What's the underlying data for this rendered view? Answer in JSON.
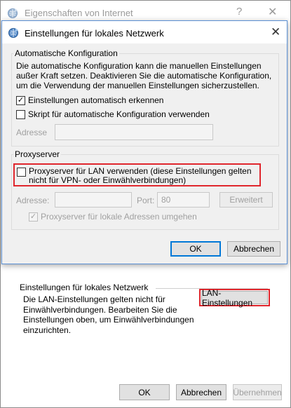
{
  "outer_window": {
    "title": "Eigenschaften von Internet",
    "help_glyph": "?",
    "close_glyph": "✕",
    "lan_group": {
      "legend": "Einstellungen für lokales Netzwerk",
      "description": "Die LAN-Einstellungen gelten nicht für Einwählverbindungen. Bearbeiten Sie die Einstellungen oben, um Einwählverbindungen einzurichten.",
      "lan_button": "LAN-Einstellungen"
    },
    "footer": {
      "ok": "OK",
      "cancel": "Abbrechen",
      "apply": "Übernehmen"
    }
  },
  "dialog": {
    "title": "Einstellungen für lokales Netzwerk",
    "close_glyph": "✕",
    "auto_config": {
      "legend": "Automatische Konfiguration",
      "description": "Die automatische Konfiguration kann die manuellen Einstellungen außer Kraft setzen. Deaktivieren Sie die automatische Konfiguration, um die Verwendung der manuellen Einstellungen sicherzustellen.",
      "auto_detect_label": "Einstellungen automatisch erkennen",
      "auto_detect_checked": true,
      "script_label": "Skript für automatische Konfiguration verwenden",
      "script_checked": false,
      "address_label": "Adresse",
      "address_value": ""
    },
    "proxy": {
      "legend": "Proxyserver",
      "use_proxy_label": "Proxyserver für LAN verwenden (diese Einstellungen gelten nicht für VPN- oder Einwählverbindungen)",
      "use_proxy_checked": false,
      "address_label": "Adresse:",
      "address_value": "",
      "port_label": "Port:",
      "port_value": "80",
      "advanced_button": "Erweitert",
      "bypass_label": "Proxyserver für lokale Adressen umgehen",
      "bypass_checked": true
    },
    "buttons": {
      "ok": "OK",
      "cancel": "Abbrechen"
    }
  },
  "colors": {
    "highlight": "#e0262d",
    "accent": "#0078d7"
  }
}
